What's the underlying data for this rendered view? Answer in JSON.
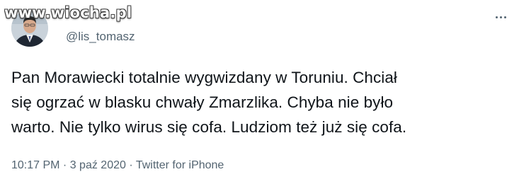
{
  "watermark": "www.wiocha.pl",
  "author": {
    "handle": "@lis_tomasz",
    "avatar_icon": "profile-photo"
  },
  "more_icon": "ellipsis-icon",
  "tweet": {
    "lines": [
      "Pan Morawiecki totalnie wygwizdany w Toruniu. Chciał",
      "się ogrzać w blasku chwały Zmarzlika. Chyba nie było",
      "warto. Nie tylko wirus się cofa. Ludziom też już się cofa."
    ]
  },
  "meta": {
    "time": "10:17 PM",
    "separator1": " · ",
    "date": "3 paź 2020",
    "separator2": " · ",
    "source": "Twitter for iPhone"
  },
  "colors": {
    "text": "#0f1419",
    "secondary": "#536471",
    "background": "#ffffff"
  }
}
